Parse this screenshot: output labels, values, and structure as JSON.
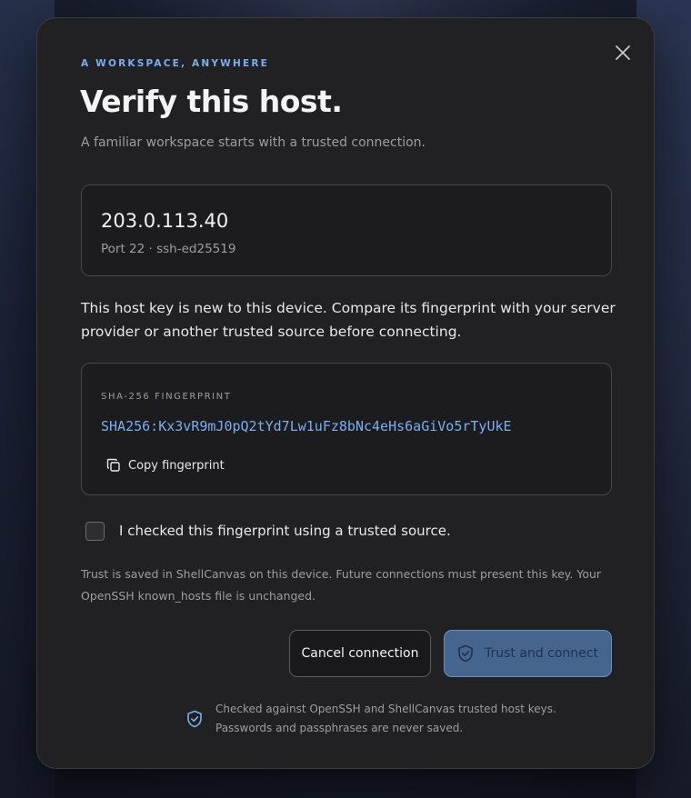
{
  "dialog": {
    "eyebrow": "A WORKSPACE, ANYWHERE",
    "title": "Verify this host.",
    "subtitle": "A familiar workspace starts with a trusted connection.",
    "close_icon": "close-icon"
  },
  "host": {
    "address": "203.0.113.40",
    "meta": "Port 22 · ssh-ed25519"
  },
  "notice": "This host key is new to this device. Compare its fingerprint with your server provider or another trusted source before connecting.",
  "fingerprint": {
    "label": "SHA-256 FINGERPRINT",
    "value": "SHA256:Kx3vR9mJ0pQ2tYd7Lw1uFz8bNc4eHs6aGiVo5rTyUkE",
    "copy_label": "Copy fingerprint",
    "copy_icon": "copy-icon"
  },
  "confirm": {
    "checked": false,
    "label": "I checked this fingerprint using a trusted source."
  },
  "fineprint": "Trust is saved in ShellCanvas on this device. Future connections must present this key. Your OpenSSH known_hosts file is unchanged.",
  "actions": {
    "cancel_label": "Cancel connection",
    "trust_label": "Trust and connect",
    "trust_icon": "shield-icon"
  },
  "footer": {
    "line1": "Checked against OpenSSH and ShellCanvas trusted host keys.",
    "line2": "Passwords and passphrases are never saved.",
    "icon": "shield-check-icon"
  },
  "colors": {
    "accent": "#7aaef0",
    "dialog_bg": "#212123",
    "primary_button": "#46658e"
  }
}
